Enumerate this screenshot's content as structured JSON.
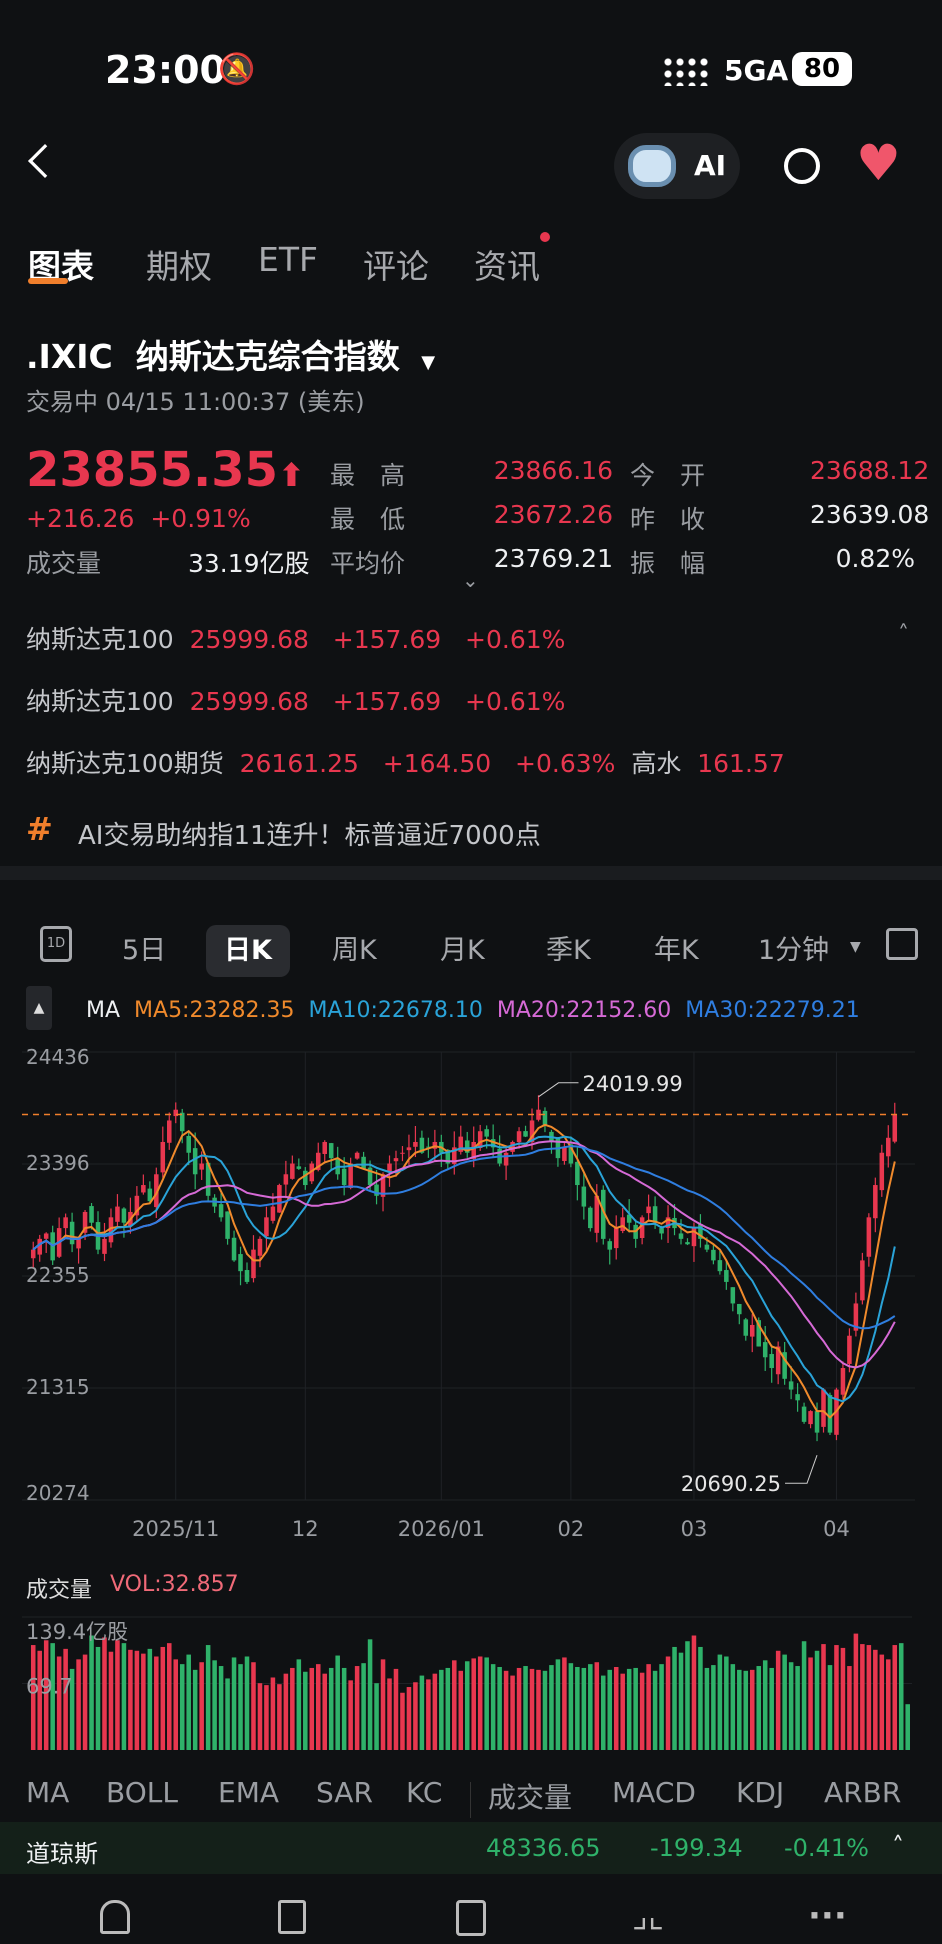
{
  "status": {
    "time": "23:00",
    "network": "5GA",
    "battery": "80"
  },
  "header": {
    "ai_label": "AI"
  },
  "tabs": [
    "图表",
    "期权",
    "ETF",
    "评论",
    "资讯"
  ],
  "stock": {
    "symbol": ".IXIC",
    "name": "纳斯达克综合指数",
    "status": "交易中 04/15 11:00:37 (美东)",
    "price": "23855.35",
    "change": "+216.26",
    "change_pct": "+0.91%"
  },
  "stats": [
    {
      "label": "最　高",
      "value": "23866.16",
      "color": "red"
    },
    {
      "label": "今　开",
      "value": "23688.12",
      "color": "red"
    },
    {
      "label": "最　低",
      "value": "23672.26",
      "color": "red"
    },
    {
      "label": "昨　收",
      "value": "23639.08",
      "color": "white"
    },
    {
      "label": "平均价",
      "value": "23769.21",
      "color": "white"
    },
    {
      "label": "振　幅",
      "value": "0.82%",
      "color": "white"
    }
  ],
  "volume_stat": {
    "label": "成交量",
    "value": "33.19亿股"
  },
  "related": [
    {
      "name": "纳斯达克100",
      "price": "25999.68",
      "change": "+157.69",
      "pct": "+0.61%"
    },
    {
      "name": "纳斯达克100",
      "price": "25999.68",
      "change": "+157.69",
      "pct": "+0.61%"
    },
    {
      "name": "纳斯达克100期货",
      "price": "26161.25",
      "change": "+164.50",
      "pct": "+0.63%",
      "extra_label": "高水",
      "extra_value": "161.57"
    }
  ],
  "headline": "AI交易助纳指11连升！标普逼近7000点",
  "periods": [
    "5日",
    "日K",
    "周K",
    "月K",
    "季K",
    "年K",
    "1分钟"
  ],
  "ma_legend": {
    "title": "MA",
    "ma5": "MA5:23282.35",
    "ma10": "MA10:22678.10",
    "ma20": "MA20:22152.60",
    "ma30": "MA30:22279.21"
  },
  "colors": {
    "up": "#e8374f",
    "down": "#2fb26a",
    "ma5": "#f08a2c",
    "ma10": "#2aa3d8",
    "ma20": "#d66ad6",
    "ma30": "#2f7ee0"
  },
  "chart_data": {
    "type": "candlestick",
    "ylim": [
      20274,
      24436
    ],
    "y_ticks": [
      "24436",
      "23396",
      "22355",
      "21315",
      "20274"
    ],
    "x_ticks": [
      {
        "label": "2025/11",
        "index": 22
      },
      {
        "label": "12",
        "index": 42
      },
      {
        "label": "2026/01",
        "index": 63
      },
      {
        "label": "02",
        "index": 83
      },
      {
        "label": "03",
        "index": 102
      },
      {
        "label": "04",
        "index": 124
      }
    ],
    "max_label": "24019.99",
    "min_label": "20690.25",
    "close": [
      22600,
      22700,
      22750,
      22500,
      22800,
      22900,
      22650,
      22700,
      22950,
      22850,
      22600,
      22700,
      22900,
      23000,
      22850,
      22950,
      23100,
      23200,
      23050,
      23300,
      23600,
      23800,
      23900,
      23700,
      23500,
      23300,
      23400,
      23100,
      23000,
      22900,
      22700,
      22500,
      22400,
      22300,
      22600,
      22700,
      22900,
      23000,
      23200,
      23300,
      23400,
      23350,
      23200,
      23400,
      23500,
      23600,
      23450,
      23300,
      23200,
      23400,
      23500,
      23350,
      23200,
      23100,
      23300,
      23400,
      23450,
      23500,
      23550,
      23600,
      23500,
      23550,
      23600,
      23500,
      23400,
      23550,
      23650,
      23500,
      23600,
      23700,
      23650,
      23550,
      23400,
      23500,
      23600,
      23700,
      23650,
      23800,
      23900,
      23750,
      23600,
      23450,
      23550,
      23400,
      23200,
      23000,
      22800,
      23100,
      22700,
      22600,
      22800,
      22900,
      22850,
      22700,
      22900,
      23000,
      22850,
      22750,
      22900,
      22800,
      22700,
      22650,
      22800,
      22700,
      22600,
      22500,
      22400,
      22300,
      22100,
      22000,
      21800,
      21900,
      21700,
      21600,
      21500,
      21700,
      21400,
      21300,
      21200,
      21000,
      21100,
      20900,
      21300,
      20900,
      21300,
      21500,
      21800,
      22100,
      22500,
      22900,
      23200,
      23500,
      23639,
      23855
    ],
    "volume_title": "成交量",
    "volume_label": "VOL:32.857",
    "volume_ticks": [
      "139.4亿股",
      "69.7"
    ],
    "volume_max": 139.4,
    "volume": [
      110,
      104,
      115,
      112,
      98,
      106,
      85,
      95,
      100,
      120,
      108,
      118,
      103,
      115,
      112,
      105,
      104,
      101,
      106,
      98,
      108,
      112,
      95,
      90,
      100,
      84,
      92,
      110,
      94,
      88,
      75,
      97,
      90,
      98,
      92,
      70,
      68,
      76,
      69,
      80,
      86,
      95,
      82,
      86,
      90,
      80,
      86,
      99,
      86,
      73,
      88,
      91,
      116,
      70,
      95,
      75,
      85,
      60,
      66,
      71,
      78,
      74,
      80,
      84,
      86,
      94,
      83,
      93,
      96,
      98,
      97,
      90,
      87,
      83,
      78,
      86,
      88,
      85,
      84,
      83,
      89,
      95,
      97,
      91,
      87,
      86,
      90,
      92,
      78,
      84,
      87,
      80,
      85,
      86,
      81,
      90,
      83,
      90,
      98,
      108,
      102,
      114,
      120,
      108,
      86,
      89,
      100,
      98,
      90,
      84,
      83,
      84,
      88,
      94,
      86,
      104,
      100,
      92,
      88,
      114,
      97,
      104,
      111,
      89,
      110,
      107,
      88,
      122,
      111,
      110,
      105,
      100,
      95,
      110,
      112,
      48
    ]
  },
  "indicator_tabs": [
    "MA",
    "BOLL",
    "EMA",
    "SAR",
    "KC",
    "成交量",
    "MACD",
    "KDJ",
    "ARBR"
  ],
  "ticker": {
    "name": "道琼斯",
    "price": "48336.65",
    "change": "-199.34",
    "pct": "-0.41%"
  }
}
